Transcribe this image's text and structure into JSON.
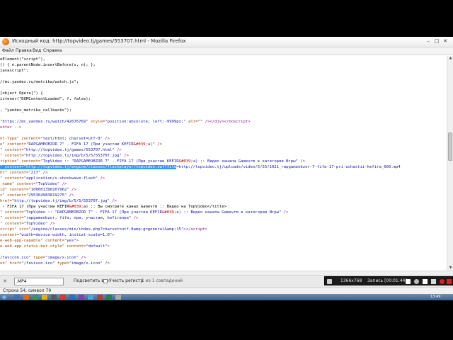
{
  "window": {
    "title": "Исходный код: http://topvideo.tj/games/553707.html - Mozilla Firefox",
    "controls": [
      "–",
      "□",
      "✕"
    ]
  },
  "menu": [
    "Файл",
    "Правка",
    "Вид",
    "Справка"
  ],
  "source_lines": [
    [
      [
        "",
        "eElement(\"script\"),"
      ]
    ],
    [
      [
        "",
        "() { n.parentNode.insertBefore(s, n); };"
      ]
    ],
    [
      [
        "",
        "javascript\";"
      ]
    ],
    [
      [
        "",
        ""
      ]
    ],
    [
      [
        "",
        "//mc.yandex.ru/metrika/watch.js\";"
      ]
    ],
    [
      [
        "",
        ""
      ]
    ],
    [
      [
        "",
        "[object Opera]\") {"
      ]
    ],
    [
      [
        "",
        "istener(\"DOMContentLoaded\", f, false);"
      ]
    ],
    [
      [
        "",
        ""
      ]
    ],
    [
      [
        "",
        ", \"yandex_metrika_callbacks\");"
      ]
    ],
    [
      [
        "",
        ""
      ]
    ],
    [
      [
        "val",
        "\"https://mc.yandex.ru/watch/42676769\""
      ],
      [
        "attr",
        " style="
      ],
      [
        "val",
        "\"position:absolute; left:-9999px;\""
      ],
      [
        "attr",
        " alt="
      ],
      [
        "val",
        "\"\""
      ],
      [
        "tag",
        " /></div></"
      ],
      [
        "tag",
        "noscript"
      ],
      [
        "tag",
        ">"
      ]
    ],
    [
      [
        "tag",
        "unter -->"
      ]
    ],
    [
      [
        "",
        ""
      ]
    ],
    [
      [
        "attr",
        "nt-Type\""
      ],
      [
        "attr",
        " content="
      ],
      [
        "val",
        "\"text/html; charset=utf-8\""
      ],
      [
        "tag",
        " />"
      ]
    ],
    [
      [
        "attr",
        "e\""
      ],
      [
        "attr",
        " content="
      ],
      [
        "val",
        "\"RAPGAMEOBZOR 7\" - FIFA 17 (При участии KEFIR"
      ],
      [
        "ent",
        "&#039;"
      ],
      [
        "val",
        "а)\""
      ],
      [
        "tag",
        " />"
      ]
    ],
    [
      [
        "attr",
        "\""
      ],
      [
        "attr",
        " content="
      ],
      [
        "val",
        "\"http://topvideo.tj/games/553707.html\""
      ],
      [
        "tag",
        " />"
      ]
    ],
    [
      [
        "attr",
        "\""
      ],
      [
        "attr",
        " content="
      ],
      [
        "val",
        "\"http://topvideo.tj/img/b/5/5/553707.jpg\""
      ],
      [
        "tag",
        " />"
      ]
    ],
    [
      [
        "attr",
        "ription\""
      ],
      [
        "attr",
        " content="
      ],
      [
        "val",
        "\"TopVideo :: \"RAPGAMEOBZOR 7\" - FIFA 17 (При участии KEFIR"
      ],
      [
        "ent",
        "&#039;"
      ],
      [
        "val",
        "а) :: Видео канала Gamevrm в категории Игры\""
      ],
      [
        "tag",
        " />"
      ]
    ],
    [
      [
        "sel",
        "\" content=\"http://topvideo.tj/engine/classes/flashplayer/topvideo.swf?file"
      ],
      [
        "val",
        "=http://topvideo.tj/uploads/video/5/55/1021_rapgameobzor-7-fifa-17-pri-uchastii-kefira_666.mp4"
      ]
    ],
    [
      [
        "attr",
        "ht\""
      ],
      [
        "attr",
        " content="
      ],
      [
        "val",
        "\"217\""
      ],
      [
        "tag",
        " />"
      ]
    ],
    [
      [
        "attr",
        "\""
      ],
      [
        "attr",
        " content="
      ],
      [
        "val",
        "\"application/x-shockwave-flash\""
      ],
      [
        "tag",
        " />"
      ]
    ],
    [
      [
        "attr",
        "_name\""
      ],
      [
        "attr",
        " content="
      ],
      [
        "val",
        "\"TopVideo\""
      ],
      [
        "tag",
        " />"
      ]
    ],
    [
      [
        "attr",
        "id\""
      ],
      [
        "attr",
        " content="
      ],
      [
        "val",
        "\"100001390207962\""
      ],
      [
        "tag",
        " />"
      ]
    ],
    [
      [
        "attr",
        "s\""
      ],
      [
        "attr",
        " content="
      ],
      [
        "val",
        "\"295364983819275\""
      ],
      [
        "tag",
        " />"
      ]
    ],
    [
      [
        "attr",
        "href="
      ],
      [
        "val",
        "\"http://topvideo.tj/img/b/5/5/553707.jpg\""
      ],
      [
        "tag",
        " />"
      ]
    ],
    [
      [
        "",
        " - FIFA 17 (При участии KEFIR"
      ],
      [
        "ent",
        "&#039;"
      ],
      [
        "",
        "а) :: Вы смотрите канал Gamevrm :: Видео на TopVideo</title>"
      ]
    ],
    [
      [
        "attr",
        "\""
      ],
      [
        "attr",
        " content="
      ],
      [
        "val",
        "\"TopVideo :: \"RAPGAMEOBZOR 7\" - FIFA 17 (При участии KEFIR"
      ],
      [
        "ent",
        "&#039;"
      ],
      [
        "val",
        "а) :: Видео канала Gamevrm в категории Игры\""
      ],
      [
        "tag",
        " />"
      ]
    ],
    [
      [
        "attr",
        "\""
      ],
      [
        "attr",
        " content="
      ],
      [
        "val",
        "\"rapgameobzor, fifa, при, участии, kefirапра\""
      ],
      [
        "tag",
        " />"
      ]
    ],
    [
      [
        "attr",
        "\""
      ],
      [
        "attr",
        " content="
      ],
      [
        "val",
        "\"TopVideo\""
      ],
      [
        "tag",
        " />"
      ]
    ],
    [
      [
        "attr",
        "script\""
      ],
      [
        "attr",
        " src="
      ],
      [
        "val",
        "\"/engine/classes/min/index.php?charset=utf-8amp;g=general&amp;15\""
      ],
      [
        "tag",
        "></"
      ],
      [
        "tag",
        "script"
      ],
      [
        "tag",
        ">"
      ]
    ],
    [
      [
        "attr",
        "content="
      ],
      [
        "val",
        "\"width=device-width, initial-scale=1.0\""
      ],
      [
        "tag",
        ">"
      ]
    ],
    [
      [
        "attr",
        "e-web-app-capable\""
      ],
      [
        "attr",
        " content="
      ],
      [
        "val",
        "\"yes\""
      ],
      [
        "tag",
        ">"
      ]
    ],
    [
      [
        "attr",
        "e-web-app-status-bar-style\""
      ],
      [
        "attr",
        " content="
      ],
      [
        "val",
        "\"default\""
      ],
      [
        "tag",
        ">"
      ]
    ],
    [
      [
        "",
        ""
      ]
    ],
    [
      [
        "val",
        "/favicon.ico\""
      ],
      [
        "attr",
        " type="
      ],
      [
        "val",
        "\"image/x-icon\""
      ],
      [
        "tag",
        " />"
      ]
    ],
    [
      [
        "attr",
        "on\""
      ],
      [
        "attr",
        " href="
      ],
      [
        "val",
        "\"/favicon.ico\""
      ],
      [
        "attr",
        " type="
      ],
      [
        "val",
        "\"image/x-icon\""
      ],
      [
        "tag",
        " />"
      ]
    ],
    [
      [
        "",
        ""
      ]
    ],
    [
      [
        "attr",
        "ef="
      ],
      [
        "val",
        "\"/templates/Default/style/engine.css\""
      ],
      [
        "attr",
        " type="
      ],
      [
        "val",
        "\"text/css\""
      ],
      [
        "attr",
        " rel="
      ],
      [
        "val",
        "\"stylesheet\""
      ],
      [
        "tag",
        " />"
      ]
    ]
  ],
  "find_bar": {
    "close": "✕",
    "query": ".MP4",
    "highlight_all": "Подсветить все",
    "match_case": "Учесть регистр",
    "status": "1 из 1 совпадений"
  },
  "recorder": {
    "resolution": "1366x768",
    "recording": "Запись [00:01:44]"
  },
  "status_bar": {
    "text": "Строка 54, символ 79"
  },
  "taskbar": {
    "clock": "13:49",
    "items": [
      "#3a73b9",
      "#e06d1d",
      "#3b9a3b",
      "#e5b200",
      "#5a5a5a",
      "#d63a2a",
      "#2b6fbd",
      "#7f3fb5",
      "#4aa3df",
      "#c0392b",
      "#1e8449",
      "#aaaaaa"
    ]
  },
  "colors": {
    "tag": "#881280",
    "attribute": "#994500",
    "value": "#1a1aa6",
    "entity": "#c80000",
    "selection": "#3399ff"
  }
}
